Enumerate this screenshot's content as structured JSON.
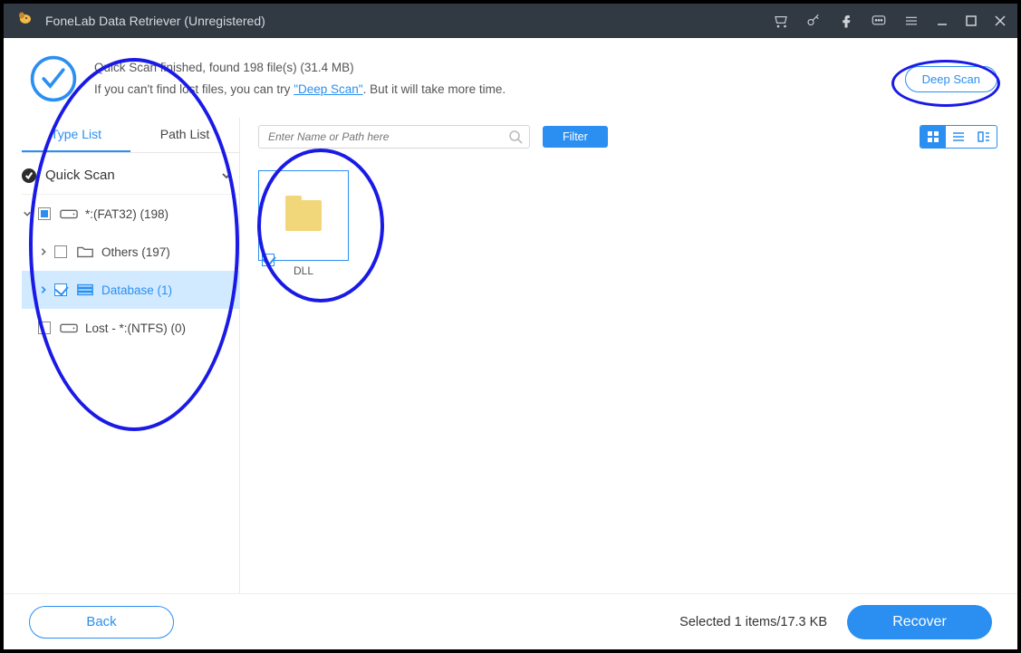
{
  "title": "FoneLab Data Retriever (Unregistered)",
  "status": {
    "line1": "Quick Scan finished, found 198 file(s) (31.4 MB)",
    "line2_prefix": "If you can't find lost files, you can try ",
    "line2_link": "\"Deep Scan\"",
    "line2_suffix": ". But it will take more time."
  },
  "deep_scan_label": "Deep Scan",
  "tabs": {
    "type_list": "Type List",
    "path_list": "Path List"
  },
  "tree": {
    "quick_scan": "Quick Scan",
    "drive": "*:(FAT32) (198)",
    "others": "Others (197)",
    "database": "Database (1)",
    "lost": "Lost - *:(NTFS) (0)"
  },
  "search_placeholder": "Enter Name or Path here",
  "filter_label": "Filter",
  "file": {
    "name": "DLL"
  },
  "footer": {
    "back": "Back",
    "selected": "Selected 1 items/17.3 KB",
    "recover": "Recover"
  }
}
